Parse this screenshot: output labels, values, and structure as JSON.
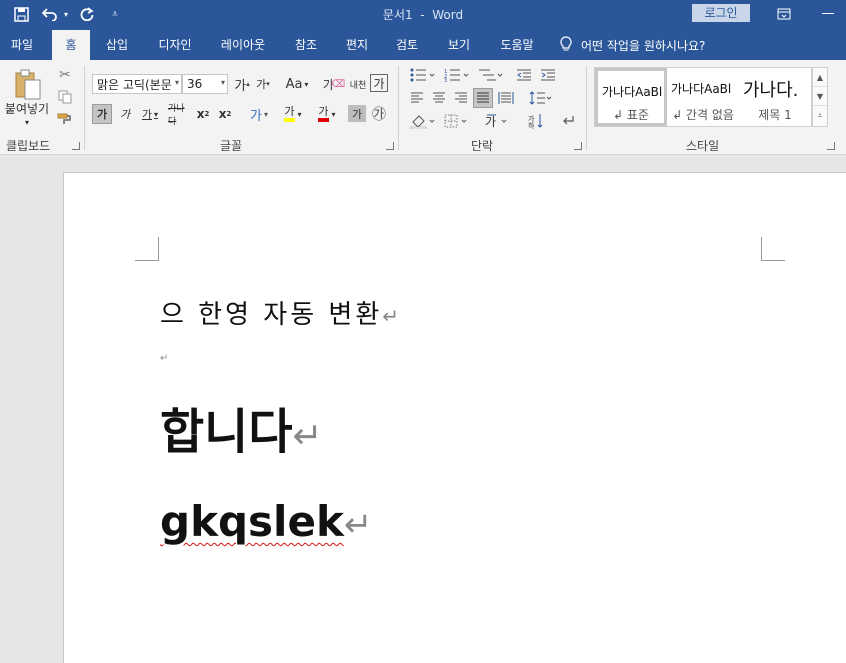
{
  "titlebar": {
    "title": "문서1",
    "separator": "-",
    "app_name": "Word",
    "login_label": "로그인",
    "icons": [
      "save-icon",
      "undo-icon",
      "redo-icon",
      "customize-qat-icon",
      "ribbon-display-icon",
      "minimize-icon"
    ]
  },
  "menubar": {
    "tabs": [
      "파일",
      "홈",
      "삽입",
      "디자인",
      "레이아웃",
      "참조",
      "편지",
      "검토",
      "보기",
      "도움말"
    ],
    "active_tab": "홈",
    "tell_me": "어떤 작업을 원하시나요?"
  },
  "ribbon": {
    "clipboard": {
      "paste_label": "붙여넣기",
      "group_label": "클립보드"
    },
    "font": {
      "font_name": "맑은 고딕(본문",
      "font_size": "36",
      "grow_label": "가",
      "shrink_label": "가",
      "case_label": "Aa",
      "clear_format_label": "가",
      "phonetic_label": "내천",
      "char_border_label": "가",
      "bold_label": "가",
      "italic_label": "가",
      "underline_label": "가",
      "strike_label": "가나다",
      "subscript_label": "x",
      "superscript_label": "x",
      "text_effect_label": "가",
      "highlight_label": "가",
      "font_color_label": "가",
      "char_shading_label": "가",
      "enclose_label": "㉮",
      "group_label": "글꼴"
    },
    "paragraph": {
      "group_label": "단락"
    },
    "styles": {
      "items": [
        {
          "preview": "가나다AaBl",
          "name": "↲ 표준"
        },
        {
          "preview": "가나다AaBl",
          "name": "↲ 간격 없음"
        },
        {
          "preview": "가나다.",
          "name": "제목 1"
        }
      ],
      "group_label": "스타일"
    }
  },
  "document": {
    "lines": [
      {
        "text": "으 한영 자동 변환",
        "mark": "↵"
      },
      {
        "text": "",
        "mark": "↵"
      },
      {
        "text": "합니다",
        "mark": "↵"
      },
      {
        "text": "gkqslek",
        "mark": "↵"
      }
    ]
  },
  "colors": {
    "brand": "#2b579a",
    "ribbon_bg": "#f3f3f3",
    "spell_error": "#d11111",
    "highlight": "#ffff00",
    "font_color": "#e00000"
  }
}
